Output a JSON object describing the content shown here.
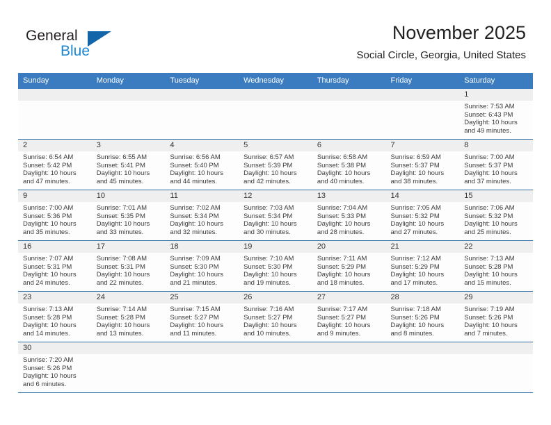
{
  "brand": {
    "name_part1": "General",
    "name_part2": "Blue",
    "triangle_color": "#1265a8",
    "blue_color": "#1c86d2"
  },
  "header": {
    "title": "November 2025",
    "location": "Social Circle, Georgia, United States"
  },
  "theme": {
    "header_row_bg": "#3b7cc0",
    "day_band_bg": "#efefef",
    "row_divider": "#2e6da4",
    "cell_bg": "#fdfdfd",
    "text": "#222222"
  },
  "weekday_headers": [
    "Sunday",
    "Monday",
    "Tuesday",
    "Wednesday",
    "Thursday",
    "Friday",
    "Saturday"
  ],
  "labels": {
    "sunrise_prefix": "Sunrise:",
    "sunset_prefix": "Sunset:",
    "daylight_prefix": "Daylight:"
  },
  "weeks": [
    [
      {
        "day": "",
        "sunrise": "",
        "sunset": "",
        "daylight": "",
        "blank": true
      },
      {
        "day": "",
        "sunrise": "",
        "sunset": "",
        "daylight": "",
        "blank": true
      },
      {
        "day": "",
        "sunrise": "",
        "sunset": "",
        "daylight": "",
        "blank": true
      },
      {
        "day": "",
        "sunrise": "",
        "sunset": "",
        "daylight": "",
        "blank": true
      },
      {
        "day": "",
        "sunrise": "",
        "sunset": "",
        "daylight": "",
        "blank": true
      },
      {
        "day": "",
        "sunrise": "",
        "sunset": "",
        "daylight": "",
        "blank": true
      },
      {
        "day": "1",
        "sunrise": "Sunrise: 7:53 AM",
        "sunset": "Sunset: 6:43 PM",
        "daylight": "Daylight: 10 hours and 49 minutes.",
        "blank": false
      }
    ],
    [
      {
        "day": "2",
        "sunrise": "Sunrise: 6:54 AM",
        "sunset": "Sunset: 5:42 PM",
        "daylight": "Daylight: 10 hours and 47 minutes.",
        "blank": false
      },
      {
        "day": "3",
        "sunrise": "Sunrise: 6:55 AM",
        "sunset": "Sunset: 5:41 PM",
        "daylight": "Daylight: 10 hours and 45 minutes.",
        "blank": false
      },
      {
        "day": "4",
        "sunrise": "Sunrise: 6:56 AM",
        "sunset": "Sunset: 5:40 PM",
        "daylight": "Daylight: 10 hours and 44 minutes.",
        "blank": false
      },
      {
        "day": "5",
        "sunrise": "Sunrise: 6:57 AM",
        "sunset": "Sunset: 5:39 PM",
        "daylight": "Daylight: 10 hours and 42 minutes.",
        "blank": false
      },
      {
        "day": "6",
        "sunrise": "Sunrise: 6:58 AM",
        "sunset": "Sunset: 5:38 PM",
        "daylight": "Daylight: 10 hours and 40 minutes.",
        "blank": false
      },
      {
        "day": "7",
        "sunrise": "Sunrise: 6:59 AM",
        "sunset": "Sunset: 5:37 PM",
        "daylight": "Daylight: 10 hours and 38 minutes.",
        "blank": false
      },
      {
        "day": "8",
        "sunrise": "Sunrise: 7:00 AM",
        "sunset": "Sunset: 5:37 PM",
        "daylight": "Daylight: 10 hours and 37 minutes.",
        "blank": false
      }
    ],
    [
      {
        "day": "9",
        "sunrise": "Sunrise: 7:00 AM",
        "sunset": "Sunset: 5:36 PM",
        "daylight": "Daylight: 10 hours and 35 minutes.",
        "blank": false
      },
      {
        "day": "10",
        "sunrise": "Sunrise: 7:01 AM",
        "sunset": "Sunset: 5:35 PM",
        "daylight": "Daylight: 10 hours and 33 minutes.",
        "blank": false
      },
      {
        "day": "11",
        "sunrise": "Sunrise: 7:02 AM",
        "sunset": "Sunset: 5:34 PM",
        "daylight": "Daylight: 10 hours and 32 minutes.",
        "blank": false
      },
      {
        "day": "12",
        "sunrise": "Sunrise: 7:03 AM",
        "sunset": "Sunset: 5:34 PM",
        "daylight": "Daylight: 10 hours and 30 minutes.",
        "blank": false
      },
      {
        "day": "13",
        "sunrise": "Sunrise: 7:04 AM",
        "sunset": "Sunset: 5:33 PM",
        "daylight": "Daylight: 10 hours and 28 minutes.",
        "blank": false
      },
      {
        "day": "14",
        "sunrise": "Sunrise: 7:05 AM",
        "sunset": "Sunset: 5:32 PM",
        "daylight": "Daylight: 10 hours and 27 minutes.",
        "blank": false
      },
      {
        "day": "15",
        "sunrise": "Sunrise: 7:06 AM",
        "sunset": "Sunset: 5:32 PM",
        "daylight": "Daylight: 10 hours and 25 minutes.",
        "blank": false
      }
    ],
    [
      {
        "day": "16",
        "sunrise": "Sunrise: 7:07 AM",
        "sunset": "Sunset: 5:31 PM",
        "daylight": "Daylight: 10 hours and 24 minutes.",
        "blank": false
      },
      {
        "day": "17",
        "sunrise": "Sunrise: 7:08 AM",
        "sunset": "Sunset: 5:31 PM",
        "daylight": "Daylight: 10 hours and 22 minutes.",
        "blank": false
      },
      {
        "day": "18",
        "sunrise": "Sunrise: 7:09 AM",
        "sunset": "Sunset: 5:30 PM",
        "daylight": "Daylight: 10 hours and 21 minutes.",
        "blank": false
      },
      {
        "day": "19",
        "sunrise": "Sunrise: 7:10 AM",
        "sunset": "Sunset: 5:30 PM",
        "daylight": "Daylight: 10 hours and 19 minutes.",
        "blank": false
      },
      {
        "day": "20",
        "sunrise": "Sunrise: 7:11 AM",
        "sunset": "Sunset: 5:29 PM",
        "daylight": "Daylight: 10 hours and 18 minutes.",
        "blank": false
      },
      {
        "day": "21",
        "sunrise": "Sunrise: 7:12 AM",
        "sunset": "Sunset: 5:29 PM",
        "daylight": "Daylight: 10 hours and 17 minutes.",
        "blank": false
      },
      {
        "day": "22",
        "sunrise": "Sunrise: 7:13 AM",
        "sunset": "Sunset: 5:28 PM",
        "daylight": "Daylight: 10 hours and 15 minutes.",
        "blank": false
      }
    ],
    [
      {
        "day": "23",
        "sunrise": "Sunrise: 7:13 AM",
        "sunset": "Sunset: 5:28 PM",
        "daylight": "Daylight: 10 hours and 14 minutes.",
        "blank": false
      },
      {
        "day": "24",
        "sunrise": "Sunrise: 7:14 AM",
        "sunset": "Sunset: 5:28 PM",
        "daylight": "Daylight: 10 hours and 13 minutes.",
        "blank": false
      },
      {
        "day": "25",
        "sunrise": "Sunrise: 7:15 AM",
        "sunset": "Sunset: 5:27 PM",
        "daylight": "Daylight: 10 hours and 11 minutes.",
        "blank": false
      },
      {
        "day": "26",
        "sunrise": "Sunrise: 7:16 AM",
        "sunset": "Sunset: 5:27 PM",
        "daylight": "Daylight: 10 hours and 10 minutes.",
        "blank": false
      },
      {
        "day": "27",
        "sunrise": "Sunrise: 7:17 AM",
        "sunset": "Sunset: 5:27 PM",
        "daylight": "Daylight: 10 hours and 9 minutes.",
        "blank": false
      },
      {
        "day": "28",
        "sunrise": "Sunrise: 7:18 AM",
        "sunset": "Sunset: 5:26 PM",
        "daylight": "Daylight: 10 hours and 8 minutes.",
        "blank": false
      },
      {
        "day": "29",
        "sunrise": "Sunrise: 7:19 AM",
        "sunset": "Sunset: 5:26 PM",
        "daylight": "Daylight: 10 hours and 7 minutes.",
        "blank": false
      }
    ],
    [
      {
        "day": "30",
        "sunrise": "Sunrise: 7:20 AM",
        "sunset": "Sunset: 5:26 PM",
        "daylight": "Daylight: 10 hours and 6 minutes.",
        "blank": false
      },
      {
        "day": "",
        "sunrise": "",
        "sunset": "",
        "daylight": "",
        "blank": true
      },
      {
        "day": "",
        "sunrise": "",
        "sunset": "",
        "daylight": "",
        "blank": true
      },
      {
        "day": "",
        "sunrise": "",
        "sunset": "",
        "daylight": "",
        "blank": true
      },
      {
        "day": "",
        "sunrise": "",
        "sunset": "",
        "daylight": "",
        "blank": true
      },
      {
        "day": "",
        "sunrise": "",
        "sunset": "",
        "daylight": "",
        "blank": true
      },
      {
        "day": "",
        "sunrise": "",
        "sunset": "",
        "daylight": "",
        "blank": true
      }
    ]
  ]
}
